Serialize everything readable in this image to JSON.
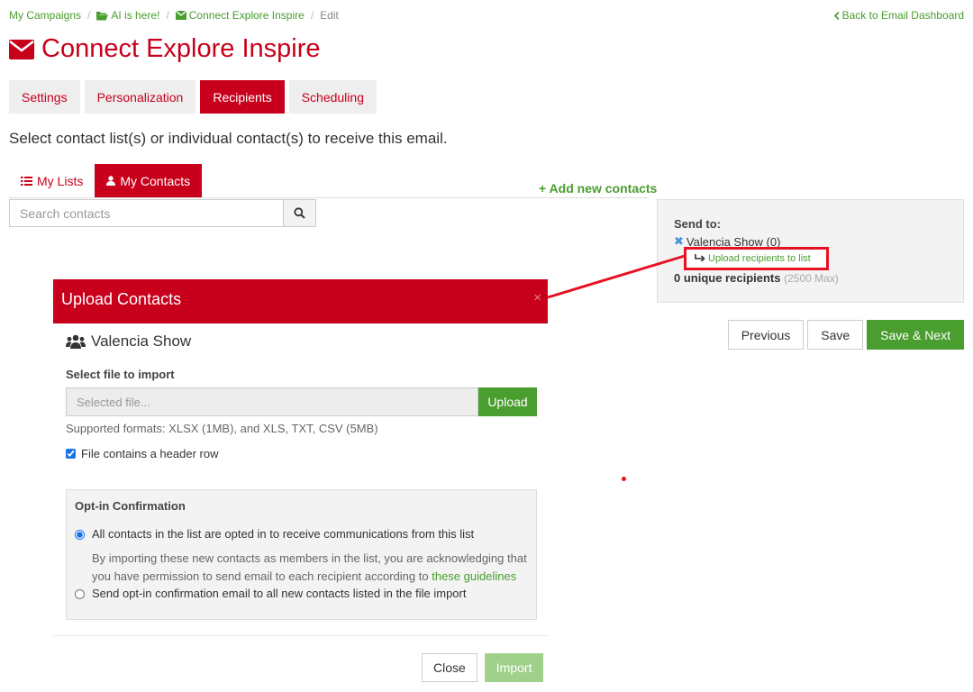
{
  "breadcrumb": {
    "items": [
      "My Campaigns",
      "AI is here!",
      "Connect Explore Inspire"
    ],
    "current": "Edit",
    "sep": "/"
  },
  "back_link": "Back to Email Dashboard",
  "page_title": "Connect Explore Inspire",
  "tabs": [
    "Settings",
    "Personalization",
    "Recipients",
    "Scheduling"
  ],
  "active_tab": "Recipients",
  "instruction": "Select contact list(s) or individual contact(s) to receive this email.",
  "subtabs": [
    "My Lists",
    "My Contacts"
  ],
  "add_contacts": "+ Add new contacts",
  "search": {
    "placeholder": "Search contacts"
  },
  "send_to": {
    "label": "Send to:",
    "item": "Valencia Show (0)",
    "upload_link": "Upload recipients to list",
    "unique": "0 unique recipients",
    "max": "(2500 Max)"
  },
  "actions": {
    "previous": "Previous",
    "save": "Save",
    "save_next": "Save & Next"
  },
  "modal": {
    "title": "Upload Contacts",
    "close": "×",
    "list_name": "Valencia Show",
    "file_label": "Select file to import",
    "file_placeholder": "Selected file...",
    "upload": "Upload",
    "formats": "Supported formats: XLSX (1MB), and XLS, TXT, CSV (5MB)",
    "header_row": "File contains a header row",
    "optin": {
      "heading": "Opt-in Confirmation",
      "option1": "All contacts in the list are opted in to receive communications from this list",
      "note": "By importing these new contacts as members in the list, you are acknowledging that you have permission to send email to each recipient according to",
      "note_link": "these guidelines",
      "option2": "Send opt-in confirmation email to all new contacts listed in the file import"
    },
    "close_button": "Close",
    "import_button": "Import"
  },
  "colors": {
    "brand_red": "#c8001b",
    "green": "#4a9d2f",
    "annotation_red": "#e81123"
  }
}
